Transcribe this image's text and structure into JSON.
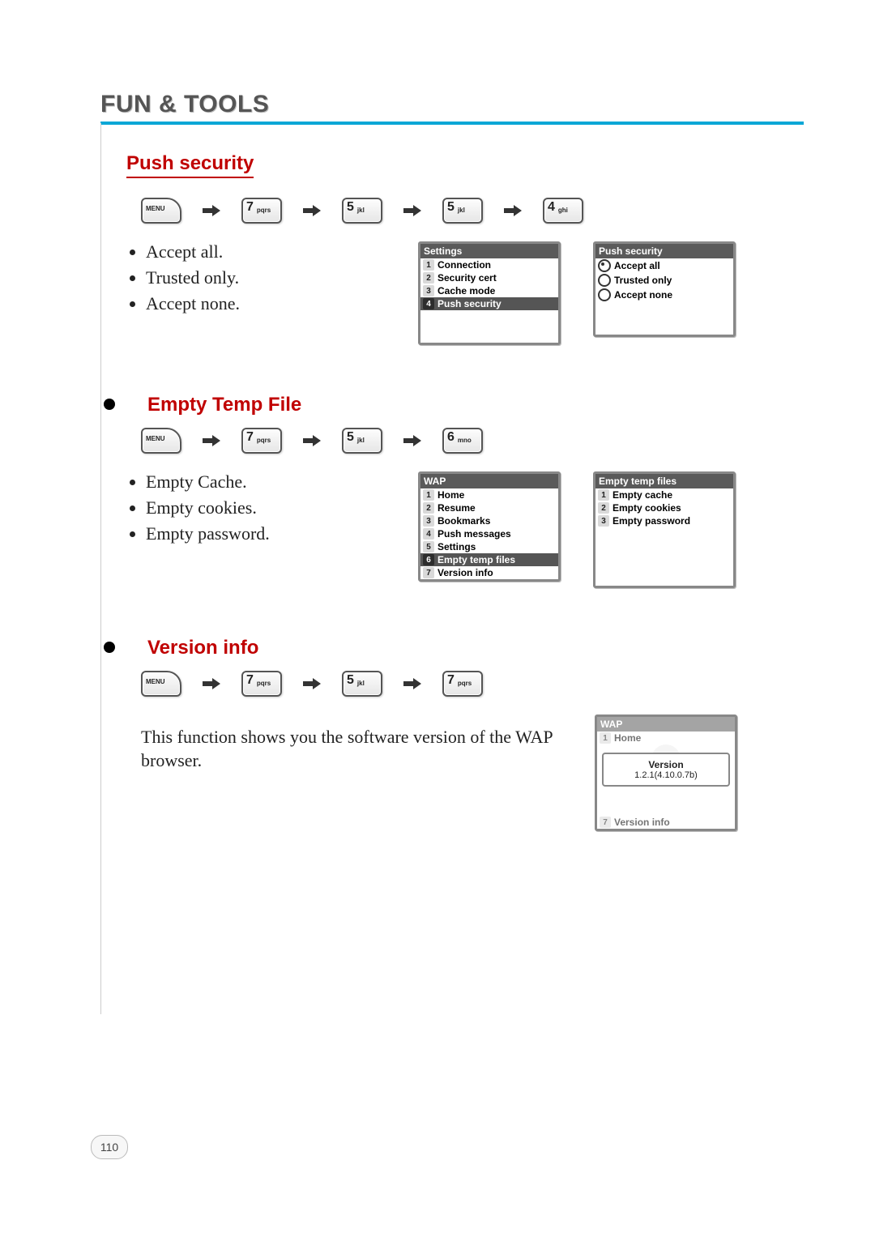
{
  "chapter_title": "FUN & TOOLS",
  "push_security": {
    "heading": "Push security",
    "keys": [
      "MENU",
      "7 pqrs",
      "5 jkl",
      "5 jkl",
      "4 ghi"
    ],
    "bullets": [
      "Accept all.",
      "Trusted only.",
      "Accept none."
    ],
    "screen_left": {
      "title": "Settings",
      "items": [
        {
          "idx": "1",
          "label": "Connection",
          "selected": false
        },
        {
          "idx": "2",
          "label": "Security cert",
          "selected": false
        },
        {
          "idx": "3",
          "label": "Cache mode",
          "selected": false
        },
        {
          "idx": "4",
          "label": "Push security",
          "selected": true
        }
      ]
    },
    "screen_right": {
      "title": "Push security",
      "items": [
        {
          "label": "Accept all",
          "selected": true
        },
        {
          "label": "Trusted only",
          "selected": false
        },
        {
          "label": "Accept none",
          "selected": false
        }
      ]
    }
  },
  "empty_temp": {
    "heading": "Empty Temp File",
    "keys": [
      "MENU",
      "7 pqrs",
      "5 jkl",
      "6 mno"
    ],
    "bullets": [
      "Empty Cache.",
      "Empty cookies.",
      "Empty password."
    ],
    "screen_left": {
      "title": "WAP",
      "items": [
        {
          "idx": "1",
          "label": "Home",
          "selected": false
        },
        {
          "idx": "2",
          "label": "Resume",
          "selected": false
        },
        {
          "idx": "3",
          "label": "Bookmarks",
          "selected": false
        },
        {
          "idx": "4",
          "label": "Push messages",
          "selected": false
        },
        {
          "idx": "5",
          "label": "Settings",
          "selected": false
        },
        {
          "idx": "6",
          "label": "Empty temp files",
          "selected": true
        },
        {
          "idx": "7",
          "label": "Version info",
          "selected": false
        }
      ]
    },
    "screen_right": {
      "title": "Empty temp files",
      "items": [
        {
          "idx": "1",
          "label": "Empty cache",
          "selected": false
        },
        {
          "idx": "2",
          "label": "Empty cookies",
          "selected": false
        },
        {
          "idx": "3",
          "label": "Empty password",
          "selected": false
        }
      ]
    }
  },
  "version_info": {
    "heading": "Version info",
    "keys": [
      "MENU",
      "7 pqrs",
      "5 jkl",
      "7 pqrs"
    ],
    "body": "This function shows you the software version of the WAP browser.",
    "screen": {
      "title": "WAP",
      "top_item": {
        "idx": "1",
        "label": "Home"
      },
      "popup_title": "Version",
      "popup_value": "1.2.1(4.10.0.7b)",
      "bottom_item": {
        "idx": "7",
        "label": "Version info"
      }
    }
  },
  "page_number": "110"
}
